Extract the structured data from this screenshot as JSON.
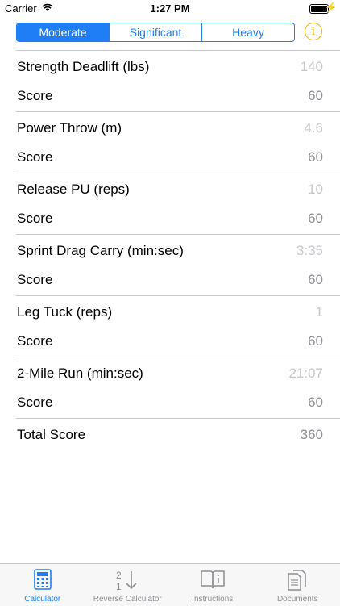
{
  "status_bar": {
    "carrier": "Carrier",
    "time": "1:27 PM",
    "battery_level": 1.0
  },
  "segmented": {
    "options": [
      "Moderate",
      "Significant",
      "Heavy"
    ],
    "selected": "Moderate"
  },
  "info_button": {
    "icon": "info-icon"
  },
  "events": [
    {
      "name": "Strength Deadlift (lbs)",
      "input": "140",
      "score_label": "Score",
      "score": "60"
    },
    {
      "name": "Power Throw (m)",
      "input": "4.6",
      "score_label": "Score",
      "score": "60"
    },
    {
      "name": "Release PU (reps)",
      "input": "10",
      "score_label": "Score",
      "score": "60"
    },
    {
      "name": "Sprint Drag Carry (min:sec)",
      "input": "3:35",
      "score_label": "Score",
      "score": "60"
    },
    {
      "name": "Leg Tuck (reps)",
      "input": "1",
      "score_label": "Score",
      "score": "60"
    },
    {
      "name": "2-Mile Run (min:sec)",
      "input": "21:07",
      "score_label": "Score",
      "score": "60"
    }
  ],
  "total": {
    "label": "Total Score",
    "value": "360"
  },
  "tabs": [
    {
      "label": "Calculator",
      "icon": "calculator-icon",
      "active": true
    },
    {
      "label": "Reverse Calculator",
      "icon": "reverse-calculator-icon",
      "active": false
    },
    {
      "label": "Instructions",
      "icon": "book-icon",
      "active": false
    },
    {
      "label": "Documents",
      "icon": "documents-icon",
      "active": false
    }
  ],
  "colors": {
    "accent": "#1f7ef5",
    "info": "#e8b400",
    "placeholder": "#c7c7cc",
    "secondary": "#8e8e93"
  }
}
